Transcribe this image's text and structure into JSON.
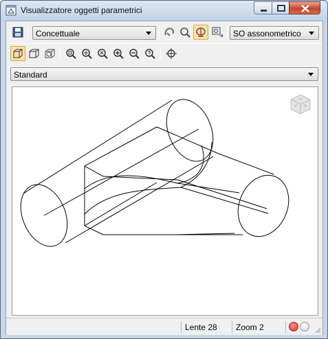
{
  "window": {
    "title": "Visualizzatore oggetti parametrici",
    "minimize_icon": "minimize-icon",
    "maximize_icon": "maximize-icon",
    "close_icon": "close-icon"
  },
  "toolbar1": {
    "save_icon": "save-icon",
    "visual_style": "Concettuale",
    "orbit_icon": "orbit-icon",
    "zoom_icon": "zoom-icon",
    "pan_icon": "pan-icon",
    "display_icon": "display-options-icon",
    "view": "SO assonometrico"
  },
  "toolbar2": {
    "icons": [
      "wireframe-cube-icon",
      "shaded-cube-icon",
      "object-cube-icon",
      "zoom-window-icon",
      "zoom-in-icon",
      "zoom-extents-icon",
      "zoom-realtime-icon",
      "zoom-out-icon",
      "zoom-previous-icon",
      "target-icon"
    ]
  },
  "standard_select": {
    "value": "Standard"
  },
  "viewport": {
    "viewcube_icon": "viewcube-icon"
  },
  "status": {
    "lens": "Lente 28",
    "zoom": "Zoom 2",
    "indicators": [
      "#e84a3f",
      "#e8e8e8"
    ]
  },
  "colors": {
    "frame": "#c8d6e6",
    "active_tool": "#fce3a8"
  }
}
